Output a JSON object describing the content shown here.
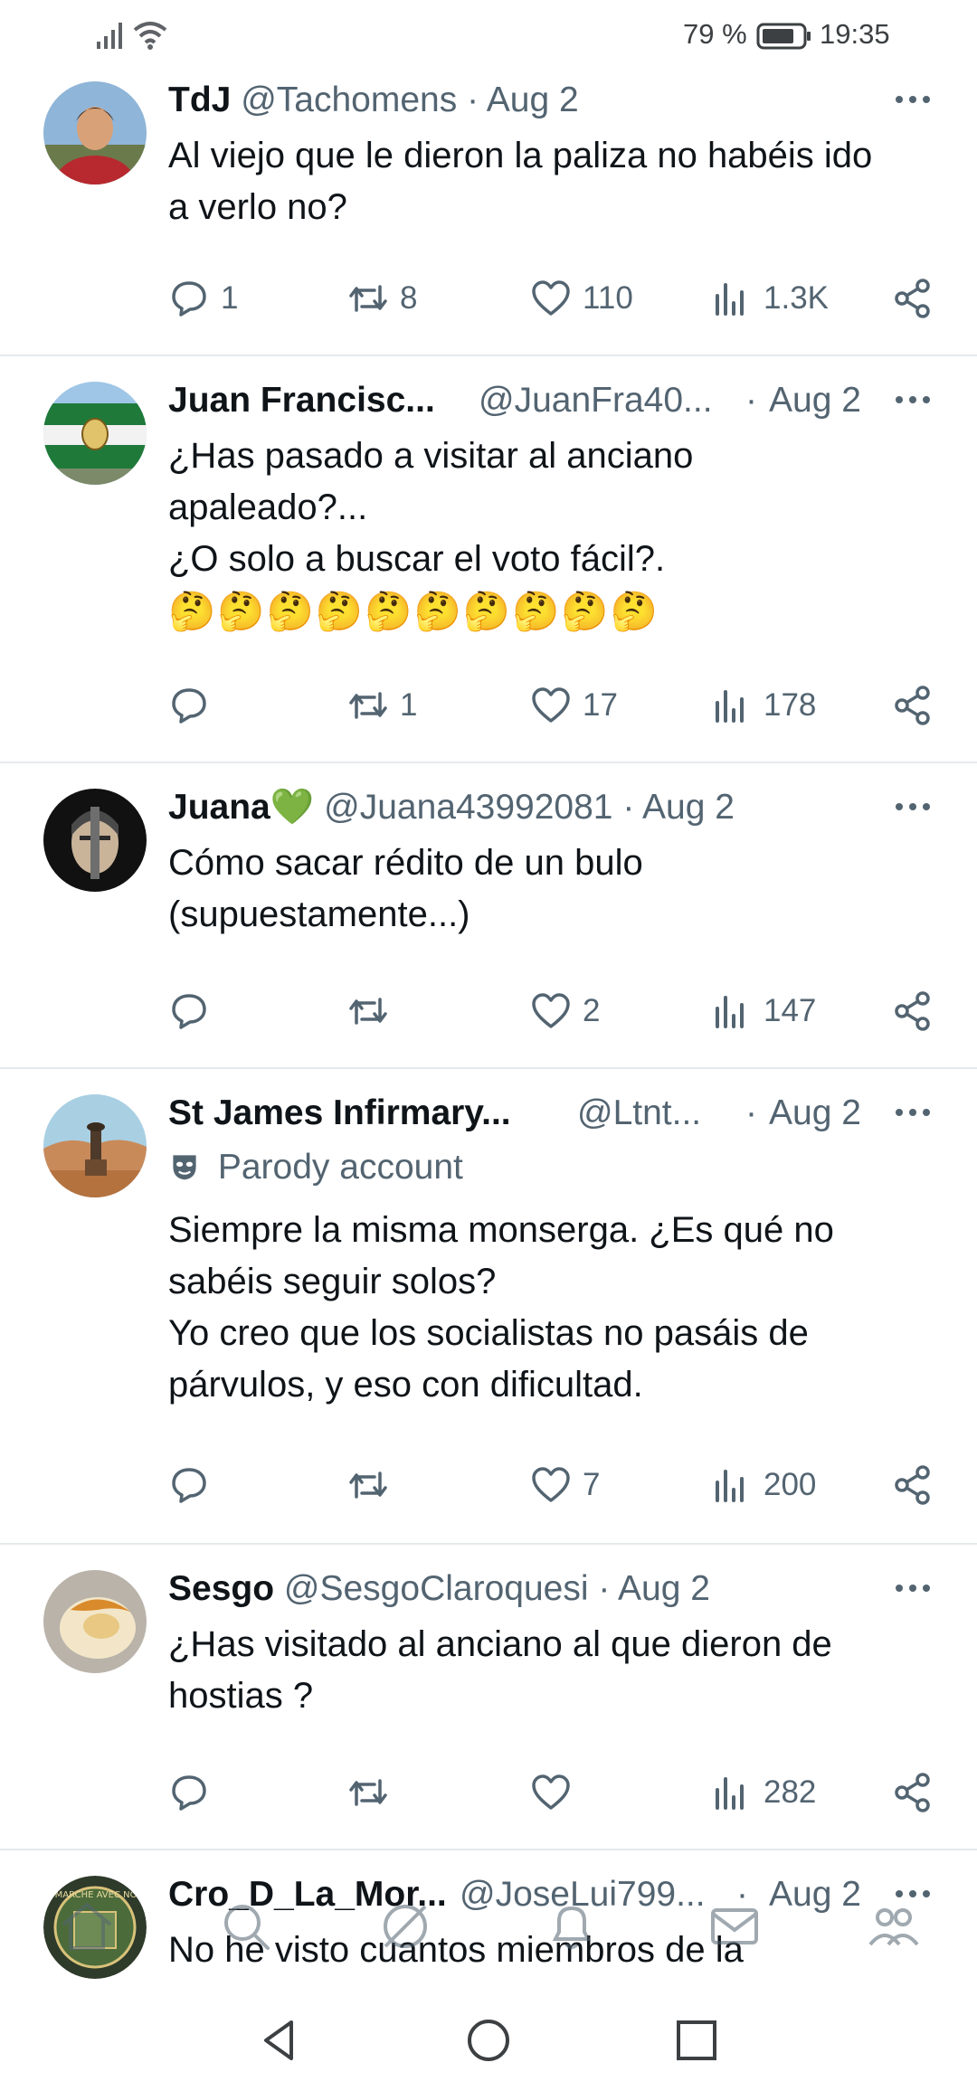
{
  "status_bar": {
    "battery": "79 %",
    "time": "19:35"
  },
  "replies": [
    {
      "name": "TdJ",
      "handle": "@Tachomens",
      "dot": "·",
      "date": "Aug 2",
      "lines": [
        "Al viejo que le dieron la paliza no habéis ido",
        "a verlo no?"
      ],
      "replies": "1",
      "reposts": "8",
      "likes": "110",
      "views": "1.3K"
    },
    {
      "name": "Juan Francisc...",
      "handle": "@JuanFra40...",
      "dot": "·",
      "date": "Aug 2",
      "lines": [
        "¿Has pasado a visitar al anciano",
        "apaleado?...",
        "¿O solo a buscar el voto fácil?.",
        "🤔🤔🤔🤔🤔🤔🤔🤔🤔🤔"
      ],
      "replies": "",
      "reposts": "1",
      "likes": "17",
      "views": "178"
    },
    {
      "name": "Juana💚",
      "handle": "@Juana43992081",
      "dot": "·",
      "date": "Aug 2",
      "lines": [
        "Cómo sacar rédito de un bulo",
        "(supuestamente...)"
      ],
      "replies": "",
      "reposts": "",
      "likes": "2",
      "views": "147"
    },
    {
      "name": "St James Infirmary...",
      "handle": "@Ltnt...",
      "dot": "·",
      "date": "Aug 2",
      "badge": "Parody account",
      "lines": [
        "Siempre la misma monserga. ¿Es qué no",
        "sabéis seguir solos?",
        "Yo creo que los socialistas no pasáis de",
        "párvulos, y eso con dificultad."
      ],
      "replies": "",
      "reposts": "",
      "likes": "7",
      "views": "200"
    },
    {
      "name": "Sesgo",
      "handle": "@SesgoClaroquesi",
      "dot": "·",
      "date": "Aug 2",
      "lines": [
        "¿Has visitado al anciano al que dieron de",
        "hostias ?"
      ],
      "replies": "",
      "reposts": "",
      "likes": "",
      "views": "282"
    },
    {
      "name": "Cro_D_La_Mor...",
      "handle": "@JoseLui799...",
      "dot": "·",
      "date": "Aug 2",
      "lines": [
        "No he visto cuantos miembros de la"
      ],
      "avatar_text": "LA MARCHE AVEC NOUS"
    }
  ],
  "icons": {
    "reply": "reply-icon",
    "repost": "repost-icon",
    "like": "heart-icon",
    "views": "views-icon",
    "share": "share-icon",
    "more": "more-icon",
    "parody": "parody-mask-icon"
  },
  "colors": {
    "text": "#0f1419",
    "secondary": "#536471",
    "divider": "#e6e9ec"
  }
}
